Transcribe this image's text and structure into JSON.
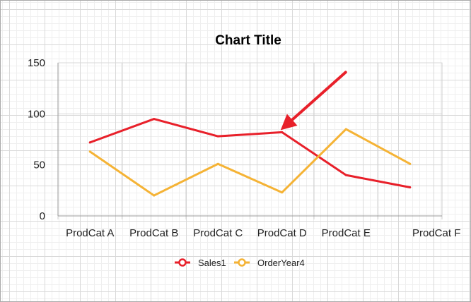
{
  "chart_data": {
    "type": "line",
    "title": "Chart Title",
    "categories": [
      "ProdCat A",
      "ProdCat B",
      "ProdCat C",
      "ProdCat D",
      "ProdCat E",
      "ProdCat F"
    ],
    "ylim": [
      0,
      150
    ],
    "yticks": [
      0,
      50,
      100,
      150
    ],
    "series": [
      {
        "name": "Sales1",
        "color": "#e8202a",
        "values": [
          72,
          95,
          78,
          82,
          40,
          28
        ]
      },
      {
        "name": "OrderYear4",
        "color": "#f5b335",
        "values": [
          63,
          20,
          51,
          23,
          85,
          51
        ]
      }
    ],
    "legend_position": "bottom",
    "annotation": {
      "type": "arrow",
      "color": "#e8202a",
      "points_to": "ProdCat D"
    },
    "grid": true
  }
}
